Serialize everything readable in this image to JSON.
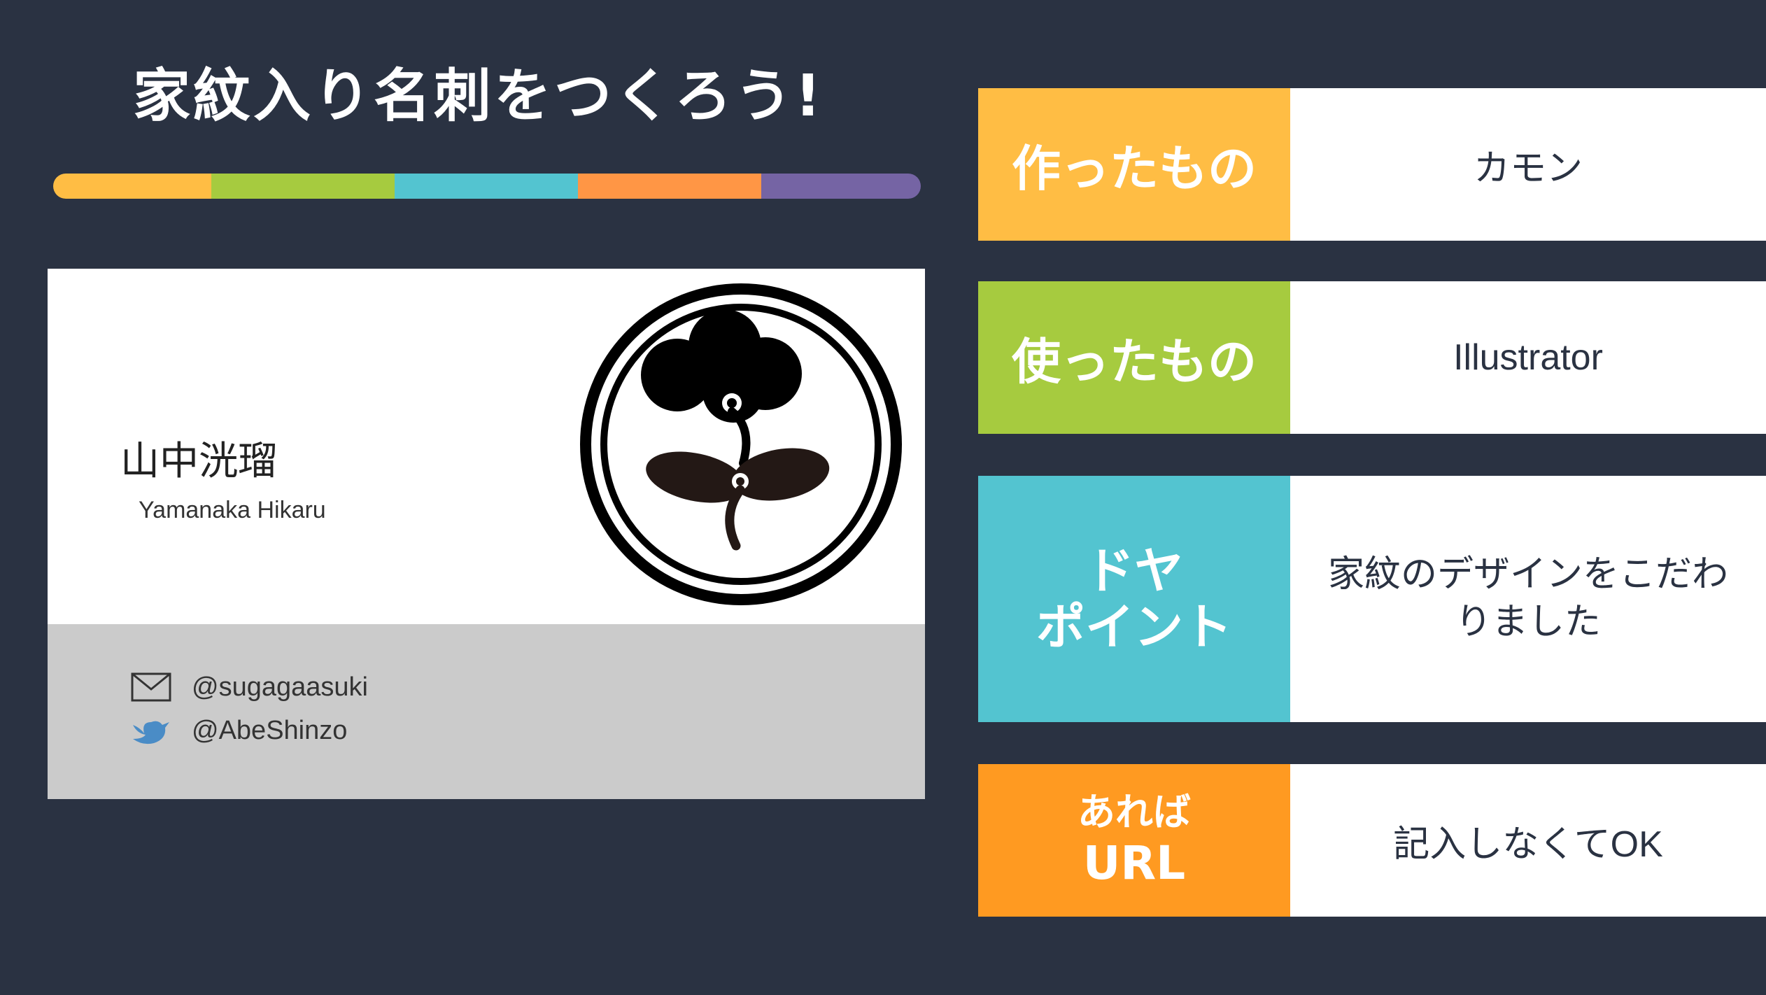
{
  "title": "家紋入り名刺をつくろう!",
  "color_bar": [
    "#ffbd44",
    "#a6cb3f",
    "#53c4d0",
    "#ff9645",
    "#7564a4"
  ],
  "card": {
    "name_jp": "山中洸瑠",
    "name_en": "Yamanaka Hikaru",
    "email": "@sugagaasuki",
    "twitter": "@AbeShinzo"
  },
  "rows": [
    {
      "label": "作ったもの",
      "value": "カモン",
      "color": "#ffbd44"
    },
    {
      "label": "使ったもの",
      "value": "Illustrator",
      "color": "#a6cb3f"
    },
    {
      "label_line1": "ドヤ",
      "label_line2": "ポイント",
      "value_line1": "家紋のデザインをこだわ",
      "value_line2": "りました",
      "color": "#53c4d0"
    },
    {
      "label_line1": "あれば",
      "label_line2": "URL",
      "value": "記入しなくてOK",
      "color": "#ff9a21"
    }
  ]
}
